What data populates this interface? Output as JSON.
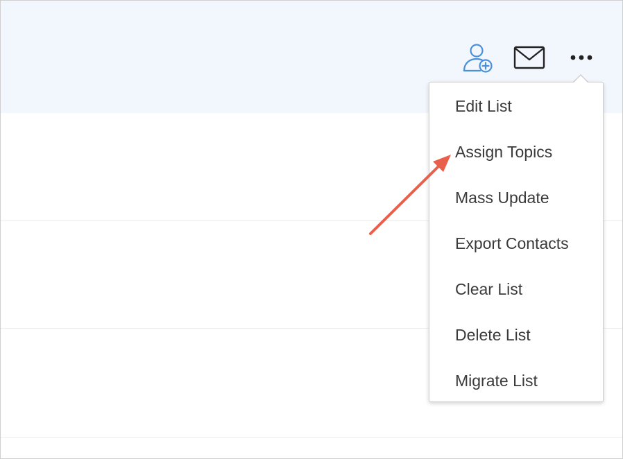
{
  "toolbar": {
    "add_contact_icon": "add-contact-icon",
    "mail_icon": "mail-icon",
    "more_icon": "more-horizontal-icon",
    "accent_color": "#4a90d9"
  },
  "menu": {
    "items": [
      {
        "label": "Edit List"
      },
      {
        "label": "Assign Topics"
      },
      {
        "label": "Mass Update"
      },
      {
        "label": "Export Contacts"
      },
      {
        "label": "Clear List"
      },
      {
        "label": "Delete List"
      },
      {
        "label": "Migrate List"
      }
    ]
  },
  "annotation": {
    "arrow_color": "#e8604c",
    "target": "Assign Topics"
  }
}
